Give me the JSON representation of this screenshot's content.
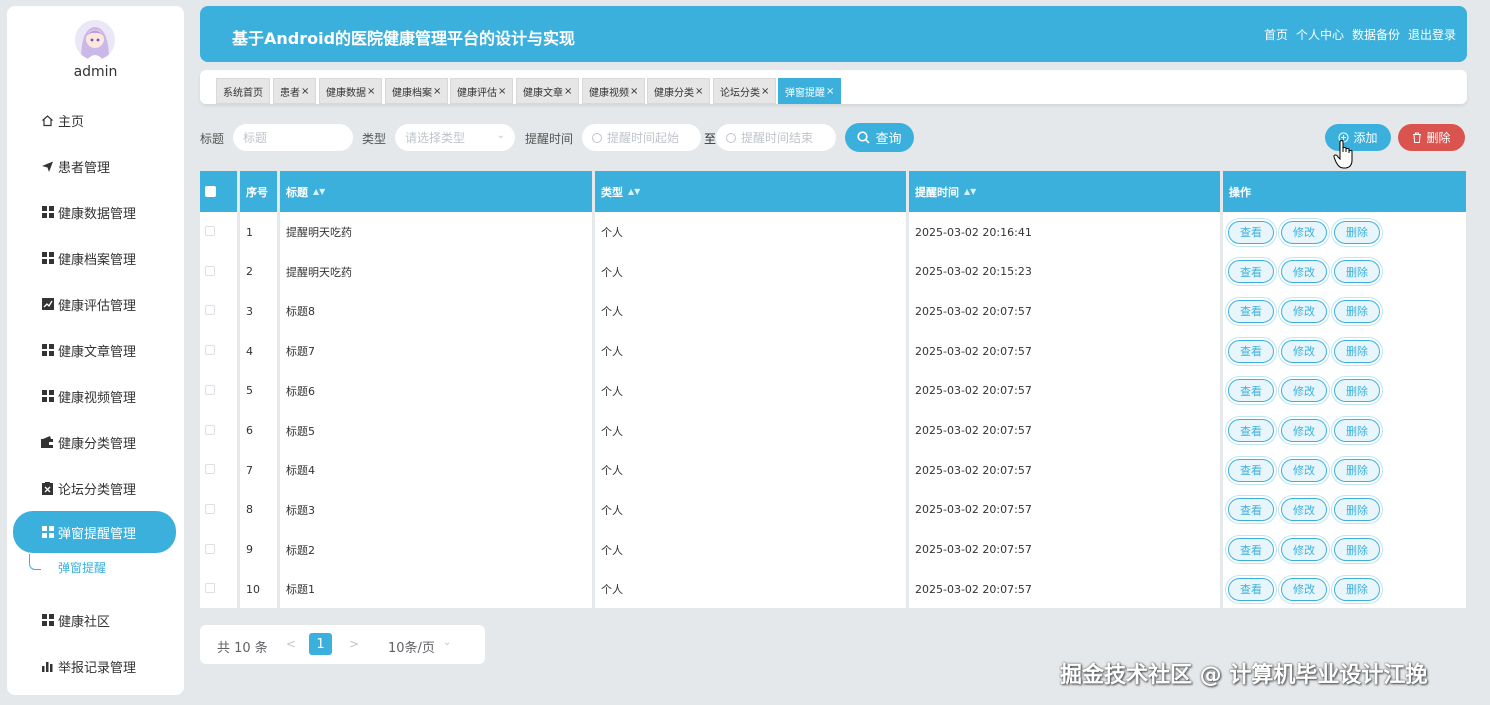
{
  "user": {
    "name": "admin"
  },
  "sidebar": {
    "items": [
      {
        "label": "主页",
        "icon": "home-icon"
      },
      {
        "label": "患者管理",
        "icon": "send-icon"
      },
      {
        "label": "健康数据管理",
        "icon": "grid-icon"
      },
      {
        "label": "健康档案管理",
        "icon": "grid-icon"
      },
      {
        "label": "健康评估管理",
        "icon": "chart-icon"
      },
      {
        "label": "健康文章管理",
        "icon": "grid-icon"
      },
      {
        "label": "健康视频管理",
        "icon": "grid-icon"
      },
      {
        "label": "健康分类管理",
        "icon": "wallet-icon"
      },
      {
        "label": "论坛分类管理",
        "icon": "clipboard-icon"
      },
      {
        "label": "弹窗提醒管理",
        "icon": "grid-icon"
      },
      {
        "label": "健康社区",
        "icon": "grid-icon"
      },
      {
        "label": "举报记录管理",
        "icon": "bar-chart-icon"
      }
    ],
    "sub_item": "弹窗提醒"
  },
  "header": {
    "title": "基于Android的医院健康管理平台的设计与实现",
    "links": [
      "首页",
      "个人中心",
      "数据备份",
      "退出登录"
    ]
  },
  "tabs": [
    {
      "label": "系统首页",
      "closable": false
    },
    {
      "label": "患者",
      "closable": true
    },
    {
      "label": "健康数据",
      "closable": true
    },
    {
      "label": "健康档案",
      "closable": true
    },
    {
      "label": "健康评估",
      "closable": true
    },
    {
      "label": "健康文章",
      "closable": true
    },
    {
      "label": "健康视频",
      "closable": true
    },
    {
      "label": "健康分类",
      "closable": true
    },
    {
      "label": "论坛分类",
      "closable": true
    },
    {
      "label": "弹窗提醒",
      "closable": true,
      "active": true
    }
  ],
  "search": {
    "title_label": "标题",
    "title_placeholder": "标题",
    "type_label": "类型",
    "type_placeholder": "请选择类型",
    "time_label": "提醒时间",
    "time_start_placeholder": "提醒时间起始",
    "time_sep": "至",
    "time_end_placeholder": "提醒时间结束",
    "search_button": "查询",
    "add_button": "添加",
    "delete_button": "删除"
  },
  "table": {
    "columns": [
      "序号",
      "标题",
      "类型",
      "提醒时间",
      "操作"
    ],
    "rows": [
      {
        "index": "1",
        "title": "提醒明天吃药",
        "type": "个人",
        "time": "2025-03-02 20:16:41"
      },
      {
        "index": "2",
        "title": "提醒明天吃药",
        "type": "个人",
        "time": "2025-03-02 20:15:23"
      },
      {
        "index": "3",
        "title": "标题8",
        "type": "个人",
        "time": "2025-03-02 20:07:57"
      },
      {
        "index": "4",
        "title": "标题7",
        "type": "个人",
        "time": "2025-03-02 20:07:57"
      },
      {
        "index": "5",
        "title": "标题6",
        "type": "个人",
        "time": "2025-03-02 20:07:57"
      },
      {
        "index": "6",
        "title": "标题5",
        "type": "个人",
        "time": "2025-03-02 20:07:57"
      },
      {
        "index": "7",
        "title": "标题4",
        "type": "个人",
        "time": "2025-03-02 20:07:57"
      },
      {
        "index": "8",
        "title": "标题3",
        "type": "个人",
        "time": "2025-03-02 20:07:57"
      },
      {
        "index": "9",
        "title": "标题2",
        "type": "个人",
        "time": "2025-03-02 20:07:57"
      },
      {
        "index": "10",
        "title": "标题1",
        "type": "个人",
        "time": "2025-03-02 20:07:57"
      }
    ],
    "actions": [
      "查看",
      "修改",
      "删除"
    ]
  },
  "pagination": {
    "total": "共 10 条",
    "prev": "<",
    "current_page": "1",
    "next": ">",
    "page_size": "10条/页"
  },
  "watermark": "掘金技术社区 @ 计算机毕业设计江挽",
  "colors": {
    "accent": "#3bb0dc",
    "danger": "#d9534f",
    "background": "#e4e8ea"
  }
}
